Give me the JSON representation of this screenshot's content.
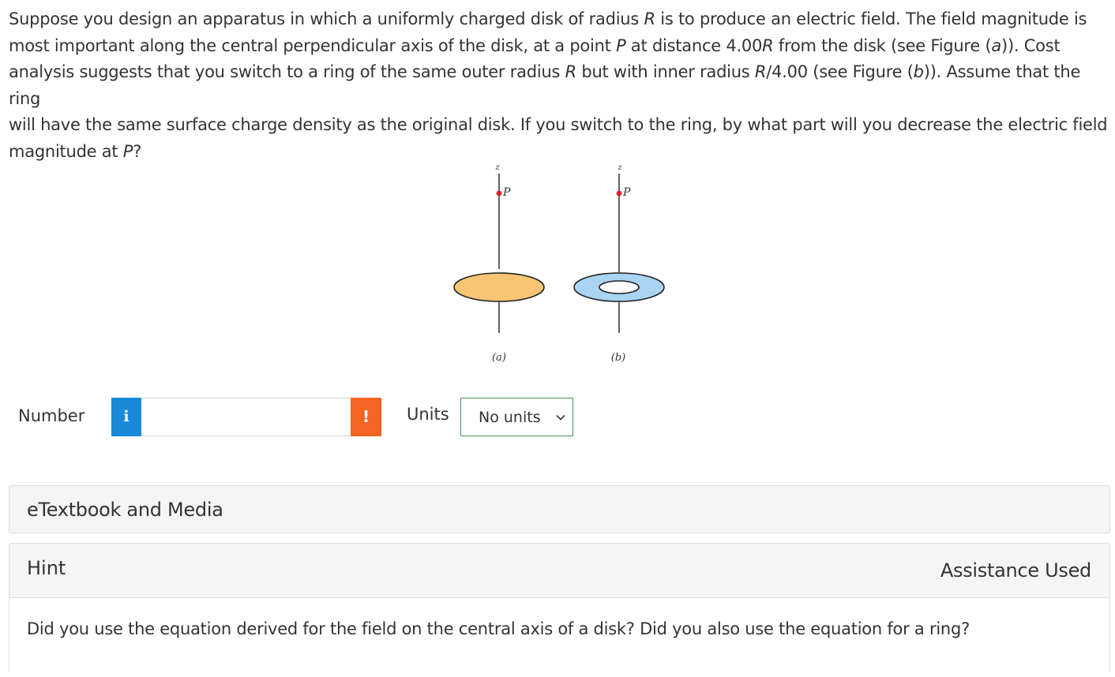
{
  "question": {
    "line1": [
      {
        "t": "Suppose you design an apparatus in which a uniformly charged disk of radius "
      },
      {
        "t": "R",
        "i": true
      },
      {
        "t": " is to produce an electric field. The field magnitude is"
      }
    ],
    "line2": [
      {
        "t": "most important along the central perpendicular axis of the disk, at a point "
      },
      {
        "t": "P",
        "i": true
      },
      {
        "t": " at distance 4.00"
      },
      {
        "t": "R",
        "i": true
      },
      {
        "t": " from the disk (see Figure ("
      },
      {
        "t": "a",
        "i": true
      },
      {
        "t": ")). Cost"
      }
    ],
    "line3": [
      {
        "t": "analysis suggests that you switch to a ring of the same outer radius "
      },
      {
        "t": "R",
        "i": true
      },
      {
        "t": " but with inner radius "
      },
      {
        "t": "R",
        "i": true
      },
      {
        "t": "/4.00 (see Figure ("
      },
      {
        "t": "b",
        "i": true
      },
      {
        "t": ")). Assume that the ring"
      }
    ],
    "line4": [
      {
        "t": "will have the same surface charge density as the original disk. If you switch to the ring, by what part will you decrease the electric field"
      }
    ],
    "line5": [
      {
        "t": "magnitude at "
      },
      {
        "t": "P",
        "i": true
      },
      {
        "t": "?"
      }
    ]
  },
  "figure": {
    "axis_label": "z",
    "point_label": "P",
    "caption_a": "(a)",
    "caption_b": "(b)",
    "colors": {
      "disk_fill": "#f7c574",
      "ring_fill": "#a9d4f2",
      "point": "#e11b22",
      "stroke": "#222222"
    }
  },
  "answer": {
    "number_label": "Number",
    "info_icon_glyph": "i",
    "number_value": "",
    "warning_icon_glyph": "!",
    "units_label": "Units",
    "units_selected": "No units",
    "colors": {
      "info": "#1a8ad8",
      "warning": "#f26522",
      "select_border": "#44905e"
    }
  },
  "etextbook": {
    "title": "eTextbook and Media"
  },
  "hint": {
    "title": "Hint",
    "status": "Assistance Used",
    "text": "Did you use the equation derived for the field on the central axis of a disk? Did you also use the equation for a ring?"
  }
}
